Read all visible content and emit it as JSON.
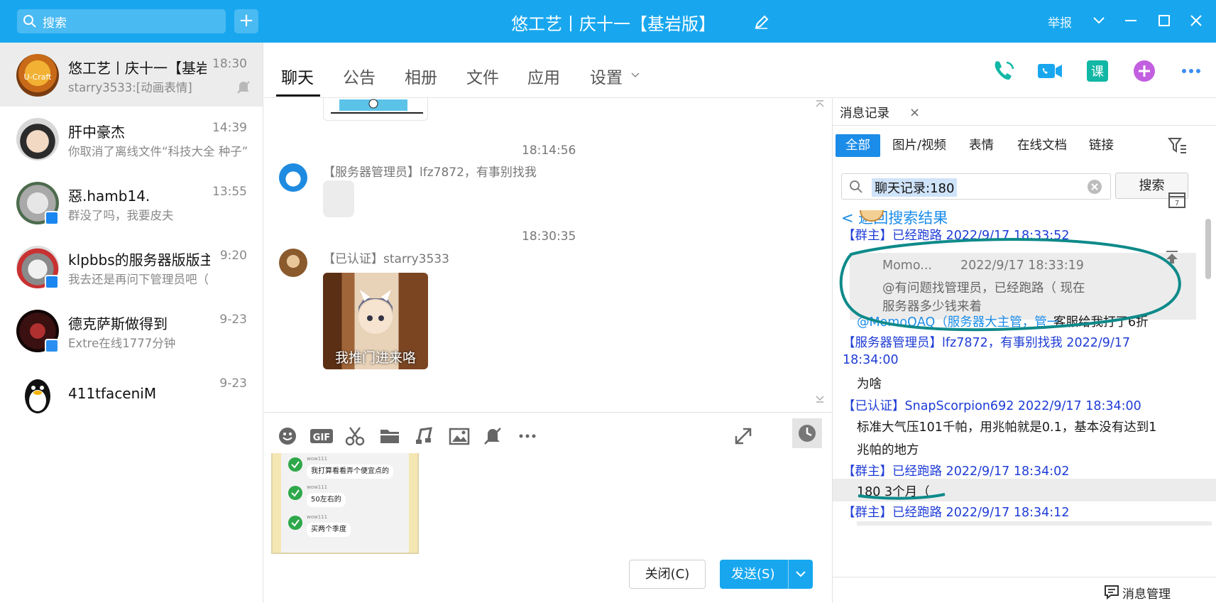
{
  "titlebar": {
    "search_placeholder": "搜索",
    "add_label": "+",
    "title": "悠工艺丨庆十一【基岩版】",
    "report_label": "举报"
  },
  "conversations": [
    {
      "name": "悠工艺丨庆十一【基岩版】",
      "time": "18:30",
      "preview": "starry3533:[动画表情]"
    },
    {
      "name": "肝中豪杰",
      "time": "14:39",
      "preview": "你取消了离线文件“科技大全 种子”"
    },
    {
      "name": "惡.hamb14.",
      "time": "13:55",
      "preview": "群没了吗，我要皮夫"
    },
    {
      "name": "klpbbs的服务器版版主",
      "time": "9:20",
      "preview": "我去还是再问下管理员吧（"
    },
    {
      "name": "德克萨斯做得到",
      "time": "9-23",
      "preview": "Extre在线1777分钟"
    },
    {
      "name": "411tfaceniM",
      "time": "9-23",
      "preview": ""
    }
  ],
  "tabs": [
    "聊天",
    "公告",
    "相册",
    "文件",
    "应用",
    "设置"
  ],
  "messages": {
    "time1": "18:14:56",
    "sender1": "【服务器管理员】lfz7872，有事别找我",
    "time2": "18:30:35",
    "sender2": "【已认证】starry3533",
    "sticker_caption": "我推门进来咯"
  },
  "input_preview": {
    "line1": "我打算看看弄个便宜点的",
    "line2": "50左右的",
    "line3": "买两个季度",
    "tag": "wow111"
  },
  "buttons": {
    "close": "关闭(C)",
    "send": "发送(S)"
  },
  "history": {
    "tab_label": "消息记录",
    "filters": [
      "全部",
      "图片/视频",
      "表情",
      "在线文档",
      "链接"
    ],
    "search_value": "聊天记录:180",
    "search_button": "搜索",
    "back_label": "< 返回搜索结果",
    "lines": [
      {
        "text": "【群主】已经跑路 2022/9/17 18:33:52",
        "kind": "blue"
      },
      {
        "text": "@MomoQAQ（服务器大主管，管一...",
        "kind": "link"
      },
      {
        "text": "客服给我打了6折",
        "kind": "text"
      },
      {
        "text": "【服务器管理员】lfz7872，有事别找我 2022/9/17",
        "kind": "blue"
      },
      {
        "text": "18:34:00",
        "kind": "blue"
      },
      {
        "text": "为啥",
        "kind": "text"
      },
      {
        "text": "【已认证】SnapScorpion692 2022/9/17 18:34:00",
        "kind": "blue"
      },
      {
        "text": "标准大气压101千帕，用兆帕就是0.1，基本没有达到1",
        "kind": "text"
      },
      {
        "text": "兆帕的地方",
        "kind": "text"
      },
      {
        "text": "【群主】已经跑路 2022/9/17 18:34:02",
        "kind": "blue"
      },
      {
        "text": "180 3个月（",
        "kind": "text"
      },
      {
        "text": "【群主】已经跑路 2022/9/17 18:34:12",
        "kind": "blue"
      }
    ],
    "quote": {
      "author": "Momo...",
      "time": "2022/9/17 18:33:19",
      "body1": "@有问题找管理员，已经跑路（ 现在",
      "body2": "服务器多少钱来着"
    },
    "footer": "消息管理"
  },
  "colors": {
    "accent": "#18a7ef",
    "link": "#1b8ce8",
    "history_name": "#1e3cd6",
    "annotation": "#0e8a8a"
  }
}
